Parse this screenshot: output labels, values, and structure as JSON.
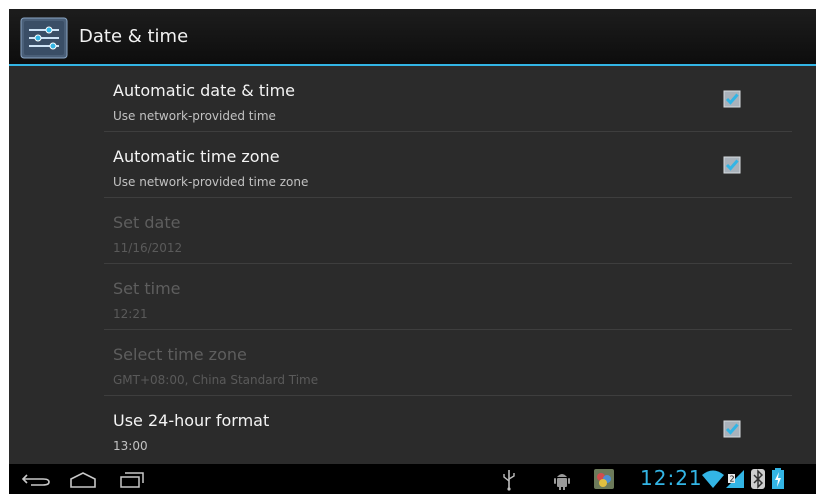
{
  "action_bar": {
    "title": "Date & time",
    "app_icon": "settings-sliders-icon"
  },
  "settings": [
    {
      "title": "Automatic date & time",
      "summary": "Use network-provided time",
      "enabled": true,
      "checkbox": true,
      "checked": true
    },
    {
      "title": "Automatic time zone",
      "summary": "Use network-provided time zone",
      "enabled": true,
      "checkbox": true,
      "checked": true
    },
    {
      "title": "Set date",
      "summary": "11/16/2012",
      "enabled": false,
      "checkbox": false
    },
    {
      "title": "Set time",
      "summary": "12:21",
      "enabled": false,
      "checkbox": false
    },
    {
      "title": "Select time zone",
      "summary": "GMT+08:00, China Standard Time",
      "enabled": false,
      "checkbox": false
    },
    {
      "title": "Use 24-hour format",
      "summary": "13:00",
      "enabled": true,
      "checkbox": true,
      "checked": true
    }
  ],
  "system_bar": {
    "clock": "12:21",
    "nav_icons": [
      "back-icon",
      "home-icon",
      "recents-icon"
    ],
    "notification_icons": [
      "usb-icon",
      "android-debug-icon",
      "app-notification-icon"
    ],
    "status_icons": [
      "wifi-icon",
      "signal-icon",
      "bluetooth-icon",
      "battery-charging-icon"
    ]
  },
  "colors": {
    "accent": "#33b5e5",
    "background": "#2b2b2b",
    "action_bar": "#131313"
  }
}
